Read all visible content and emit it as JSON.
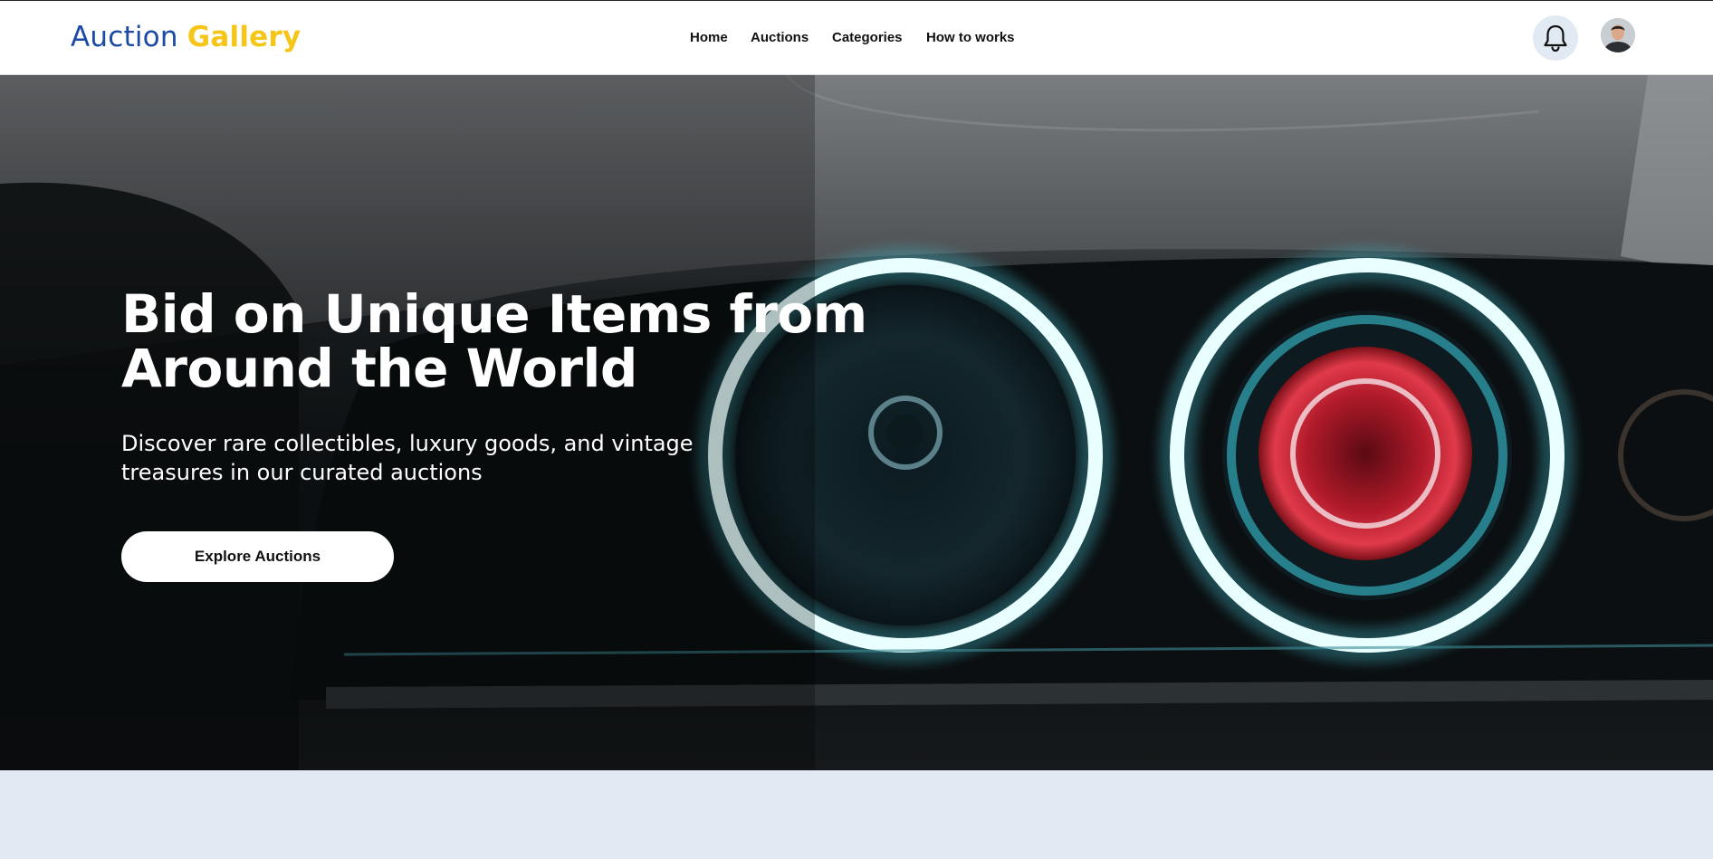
{
  "brand": {
    "part1": "Auction",
    "part2": "Gallery"
  },
  "nav": {
    "items": [
      {
        "label": "Home"
      },
      {
        "label": "Auctions"
      },
      {
        "label": "Categories"
      },
      {
        "label": "How to works"
      }
    ]
  },
  "header_icons": {
    "notifications": "bell-icon",
    "profile": "user-avatar"
  },
  "hero": {
    "title_line1": "Bid on Unique Items from",
    "title_line2": "Around the World",
    "subtitle_line1": "Discover rare collectibles, luxury goods, and vintage",
    "subtitle_line2": "treasures in our curated auctions",
    "cta_label": "Explore Auctions",
    "image": "car-headlights"
  },
  "colors": {
    "brand_blue": "#1c4aa5",
    "brand_yellow": "#f5c518",
    "page_bg": "#e1eaf3",
    "header_bg": "#ffffff"
  }
}
